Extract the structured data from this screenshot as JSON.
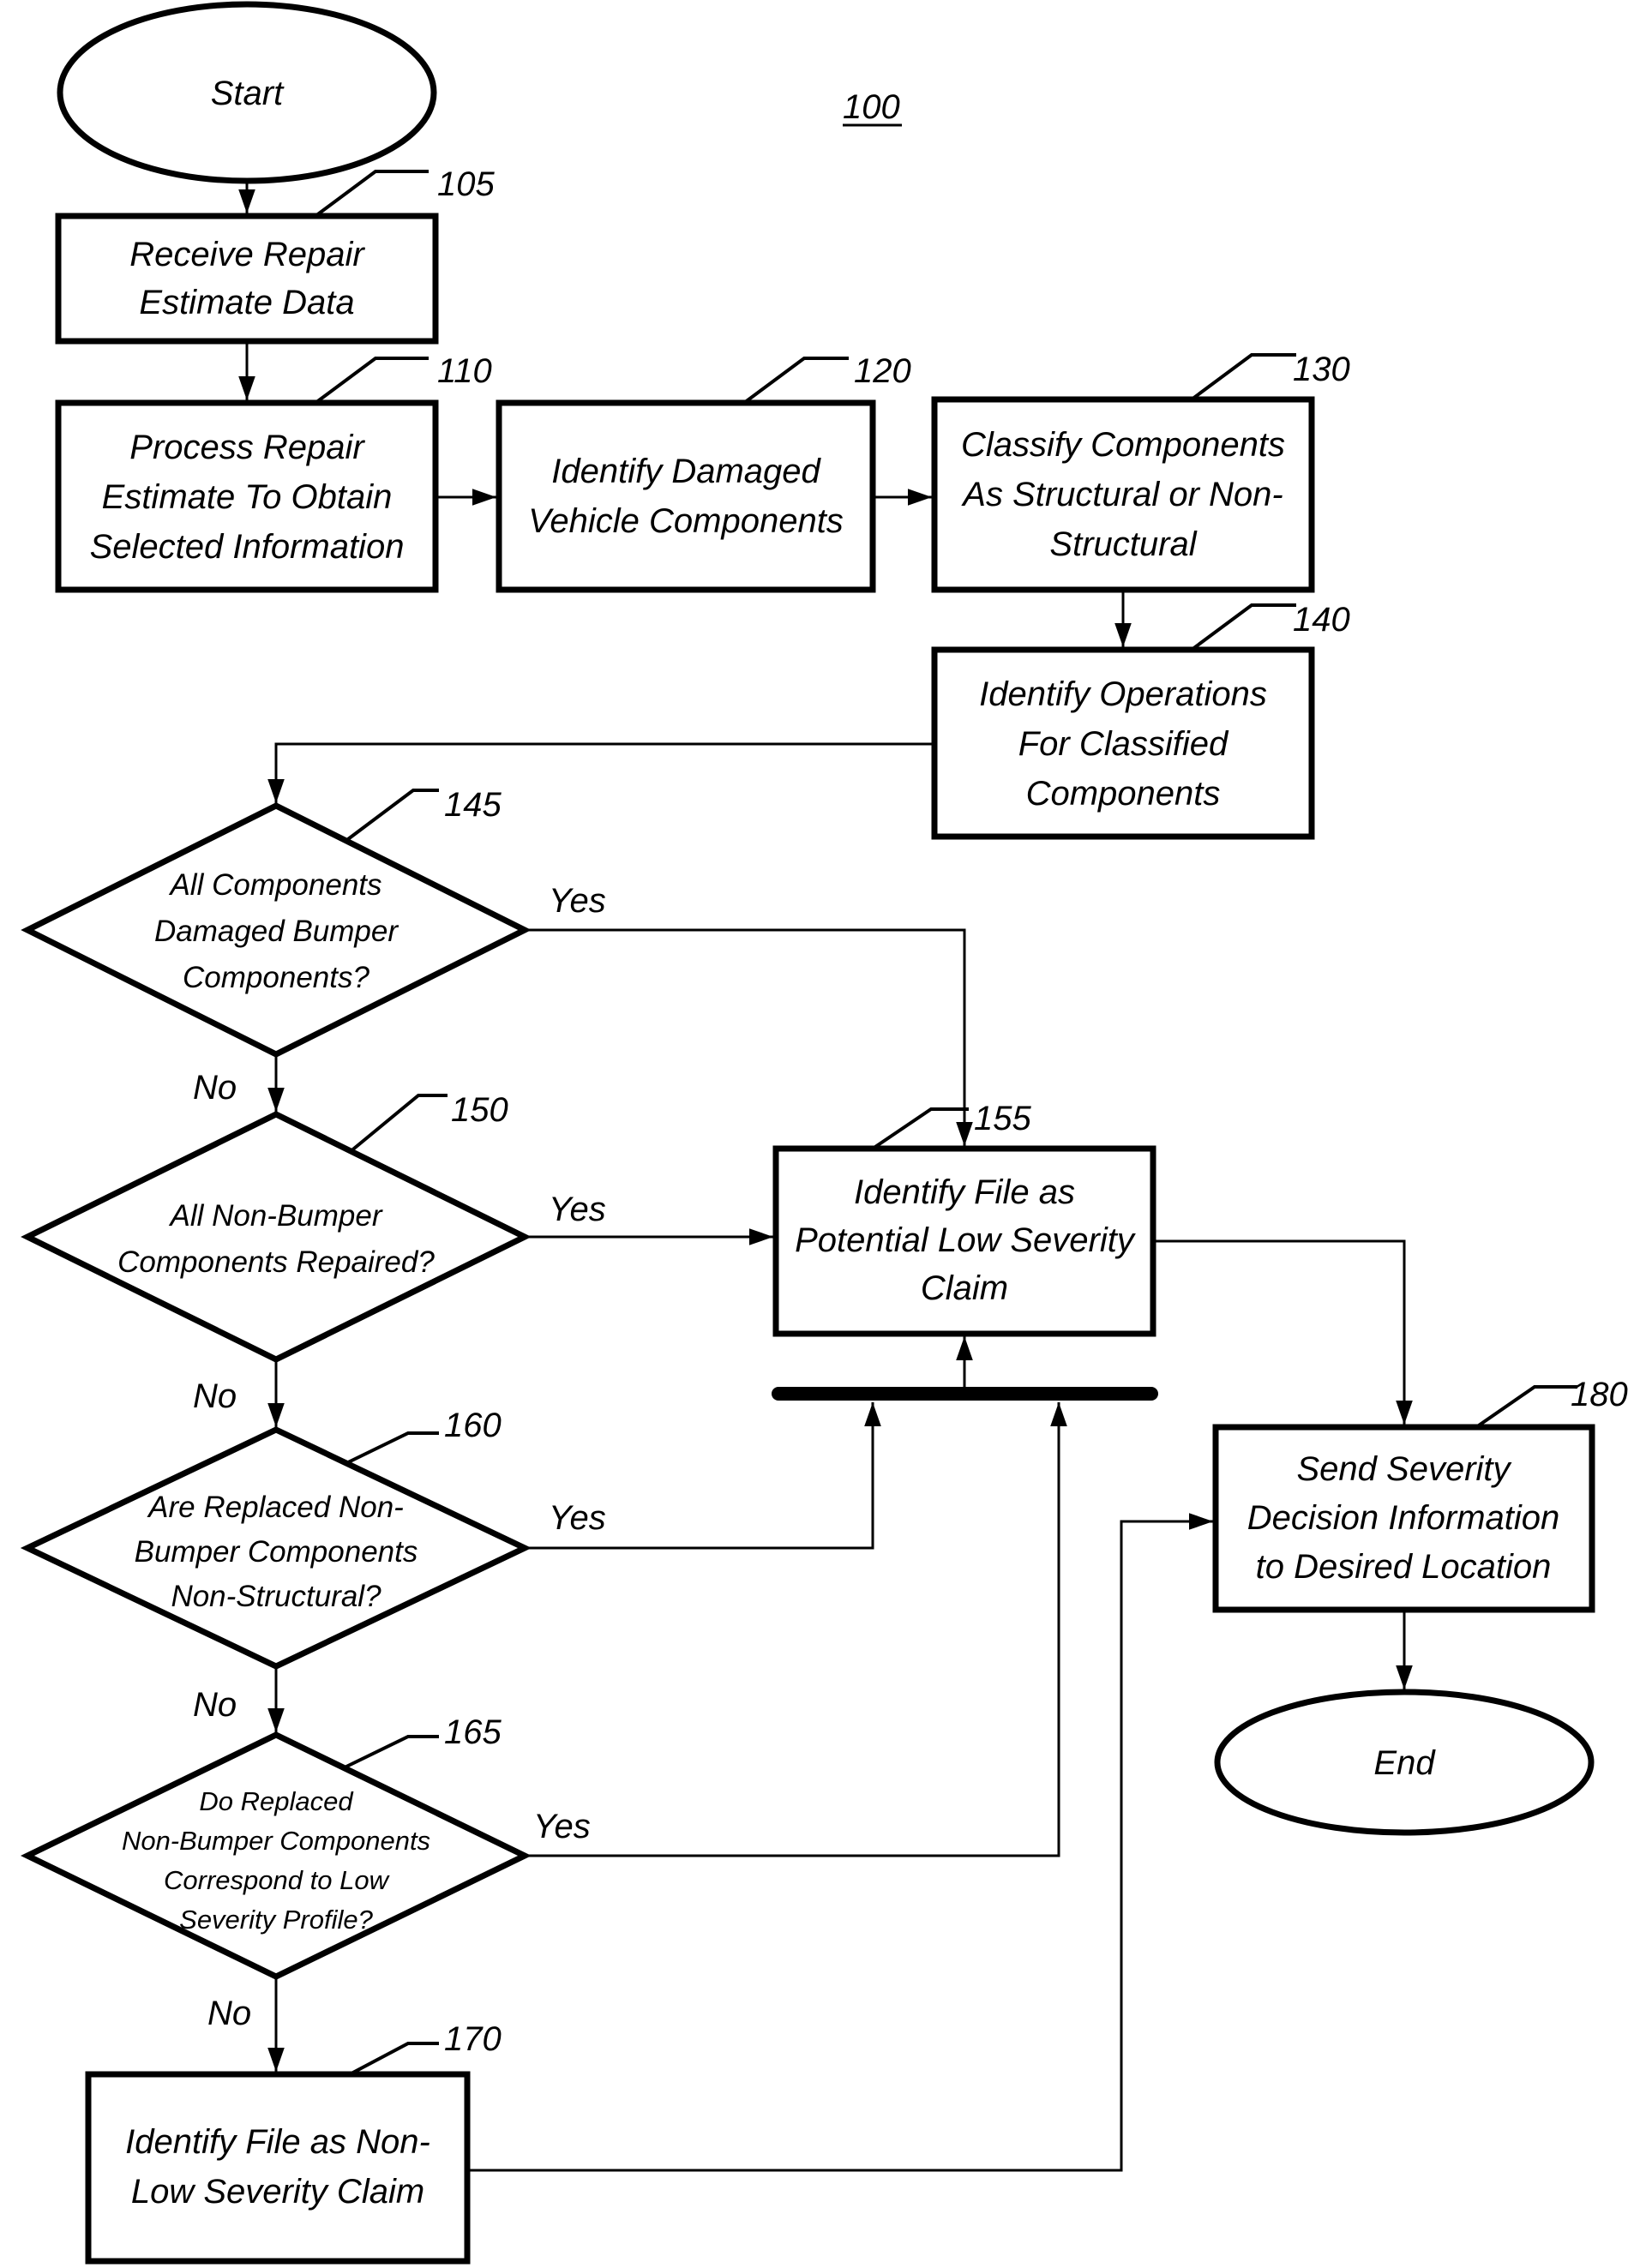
{
  "figure_number": "100",
  "nodes": {
    "start": {
      "label": "Start"
    },
    "n105": {
      "ref": "105",
      "lines": [
        "Receive Repair",
        "Estimate Data"
      ]
    },
    "n110": {
      "ref": "110",
      "lines": [
        "Process Repair",
        "Estimate To Obtain",
        "Selected Information"
      ]
    },
    "n120": {
      "ref": "120",
      "lines": [
        "Identify Damaged",
        "Vehicle Components"
      ]
    },
    "n130": {
      "ref": "130",
      "lines": [
        "Classify Components",
        "As Structural or Non-",
        "Structural"
      ]
    },
    "n140": {
      "ref": "140",
      "lines": [
        "Identify Operations",
        "For Classified",
        "Components"
      ]
    },
    "n145": {
      "ref": "145",
      "lines": [
        "All Components",
        "Damaged Bumper",
        "Components?"
      ]
    },
    "n150": {
      "ref": "150",
      "lines": [
        "All Non-Bumper",
        "Components Repaired?"
      ]
    },
    "n160": {
      "ref": "160",
      "lines": [
        "Are Replaced Non-",
        "Bumper Components",
        "Non-Structural?"
      ]
    },
    "n165": {
      "ref": "165",
      "lines": [
        "Do Replaced",
        "Non-Bumper Components",
        "Correspond to Low",
        "Severity Profile?"
      ]
    },
    "n155": {
      "ref": "155",
      "lines": [
        "Identify File as",
        "Potential Low Severity",
        "Claim"
      ]
    },
    "n170": {
      "ref": "170",
      "lines": [
        "Identify File as Non-",
        "Low Severity Claim"
      ]
    },
    "n180": {
      "ref": "180",
      "lines": [
        "Send Severity",
        "Decision Information",
        "to Desired Location"
      ]
    },
    "end": {
      "label": "End"
    }
  },
  "edge_labels": {
    "yes": "Yes",
    "no": "No"
  }
}
